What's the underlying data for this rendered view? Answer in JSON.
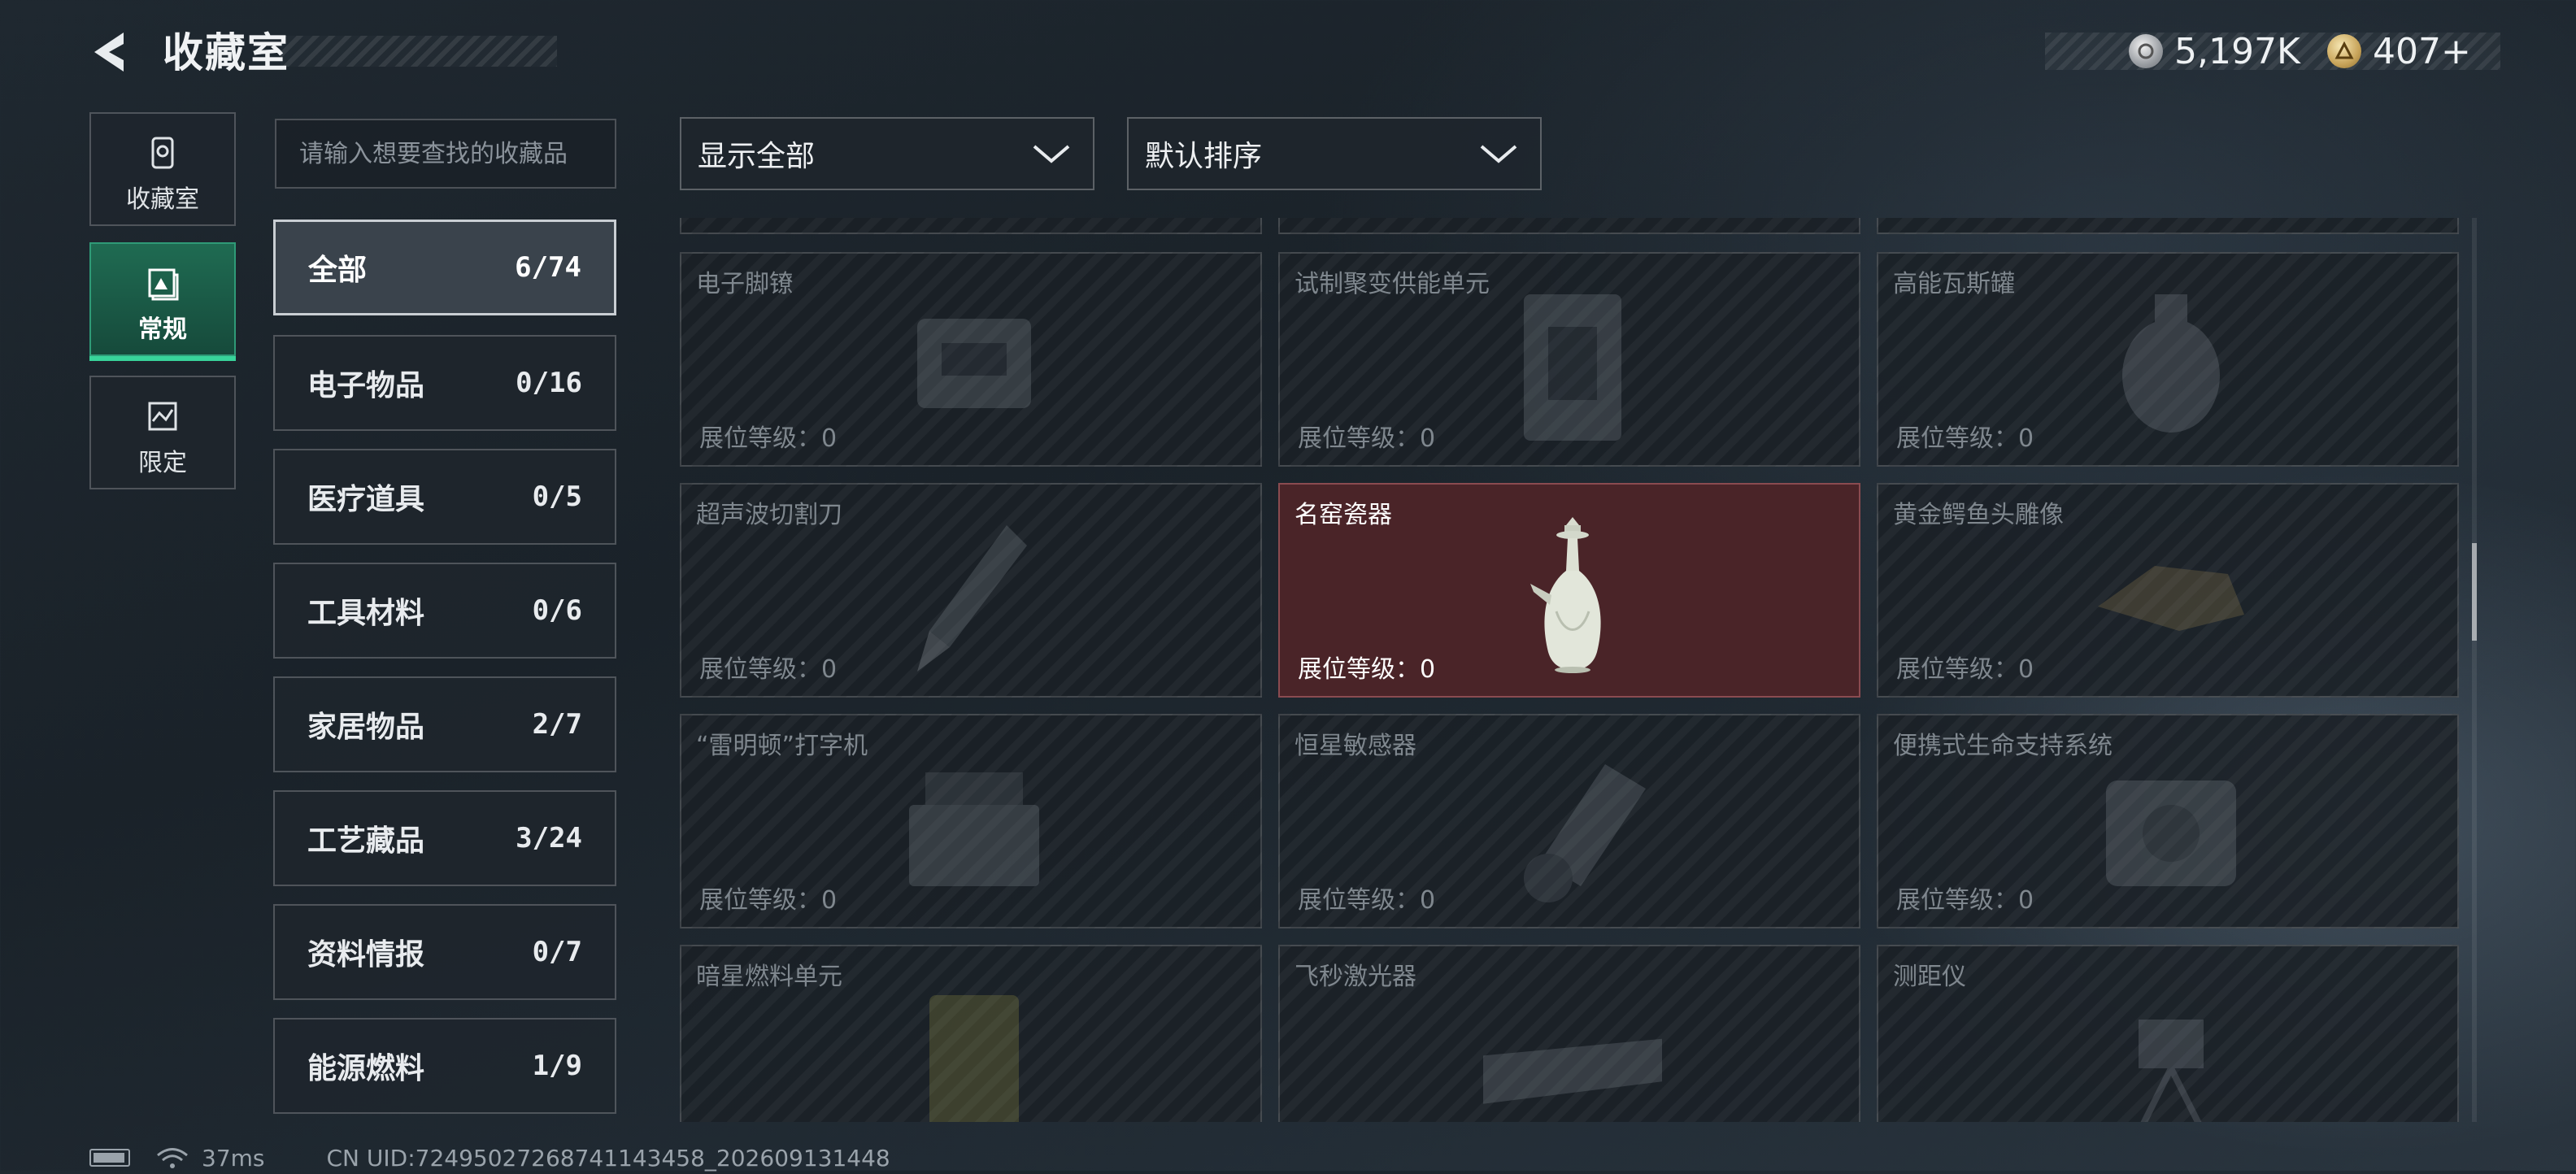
{
  "header": {
    "title": "收藏室",
    "currencies": [
      {
        "icon": "silver-coin-icon",
        "value": "5,197K"
      },
      {
        "icon": "gold-coin-icon",
        "value": "407+"
      }
    ]
  },
  "nav": {
    "items": [
      {
        "label": "收藏室",
        "icon": "collection-room-icon",
        "active": false
      },
      {
        "label": "常规",
        "icon": "regular-icon",
        "active": true
      },
      {
        "label": "限定",
        "icon": "limited-icon",
        "active": false
      }
    ]
  },
  "search": {
    "placeholder": "请输入想要查找的收藏品"
  },
  "categories": [
    {
      "name": "全部",
      "count": "6/74",
      "active": true
    },
    {
      "name": "电子物品",
      "count": "0/16"
    },
    {
      "name": "医疗道具",
      "count": "0/5"
    },
    {
      "name": "工具材料",
      "count": "0/6"
    },
    {
      "name": "家居物品",
      "count": "2/7"
    },
    {
      "name": "工艺藏品",
      "count": "3/24"
    },
    {
      "name": "资料情报",
      "count": "0/7"
    },
    {
      "name": "能源燃料",
      "count": "1/9"
    }
  ],
  "filters": {
    "display": "显示全部",
    "sort": "默认排序"
  },
  "items": [
    {
      "name": "电子脚镣",
      "level": "展位等级：0"
    },
    {
      "name": "试制聚变供能单元",
      "level": "展位等级：0"
    },
    {
      "name": "高能瓦斯罐",
      "level": "展位等级：0"
    },
    {
      "name": "超声波切割刀",
      "level": "展位等级：0"
    },
    {
      "name": "名窑瓷器",
      "level": "展位等级：0",
      "highlight": true
    },
    {
      "name": "黄金鳄鱼头雕像",
      "level": "展位等级：0"
    },
    {
      "name": "“雷明顿”打字机",
      "level": "展位等级：0"
    },
    {
      "name": "恒星敏感器",
      "level": "展位等级：0"
    },
    {
      "name": "便携式生命支持系统",
      "level": "展位等级：0"
    },
    {
      "name": "暗星燃料单元",
      "level": ""
    },
    {
      "name": "飞秒激光器",
      "level": ""
    },
    {
      "name": "测距仪",
      "level": ""
    }
  ],
  "status": {
    "ping": "37ms",
    "uid": "CN UID:72495027268741143458_202609131448"
  },
  "colors": {
    "accent_green": "#38d49a",
    "highlight_card": "#4a2428"
  }
}
